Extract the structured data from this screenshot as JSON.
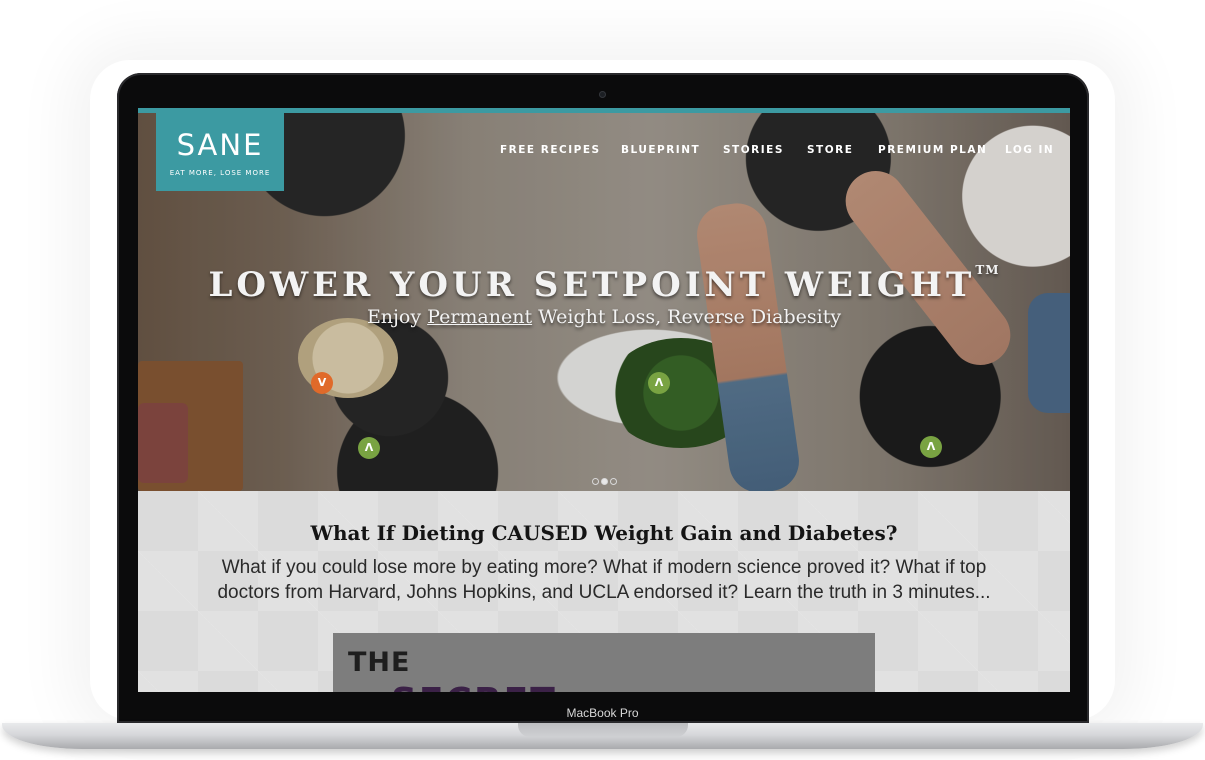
{
  "device": {
    "model_label": "MacBook Pro"
  },
  "site": {
    "brand": "SANE",
    "tagline": "EAT MORE, LOSE MORE",
    "accent_color": "#3c9aa2",
    "nav": [
      {
        "label": "FREE RECIPES"
      },
      {
        "label": "BLUEPRINT"
      },
      {
        "label": "STORIES"
      },
      {
        "label": "STORE"
      },
      {
        "label": "PREMIUM PLAN"
      },
      {
        "label": "LOG IN"
      }
    ]
  },
  "hero": {
    "title": "LOWER YOUR SETPOINT WEIGHT",
    "trademark": "TM",
    "subtitle_before": "Enjoy ",
    "subtitle_link": "Permanent",
    "subtitle_after": " Weight Loss, Reverse Diabesity",
    "badges": [
      {
        "glyph": "V",
        "color": "#e06a2a"
      },
      {
        "glyph": "Λ",
        "color": "#79a342"
      },
      {
        "glyph": "Λ",
        "color": "#79a342"
      },
      {
        "glyph": "Λ",
        "color": "#79a342"
      }
    ],
    "carousel": {
      "slides": 3,
      "active_index": 1
    }
  },
  "intro": {
    "headline": "What If Dieting CAUSED Weight Gain and Diabetes?",
    "body": "What if you could lose more by eating more? What if modern science proved it? What if top doctors from Harvard, Johns Hopkins, and UCLA endorsed it? Learn the truth in 3 minutes..."
  },
  "video": {
    "line1": "THE",
    "line2": "SECRET"
  }
}
